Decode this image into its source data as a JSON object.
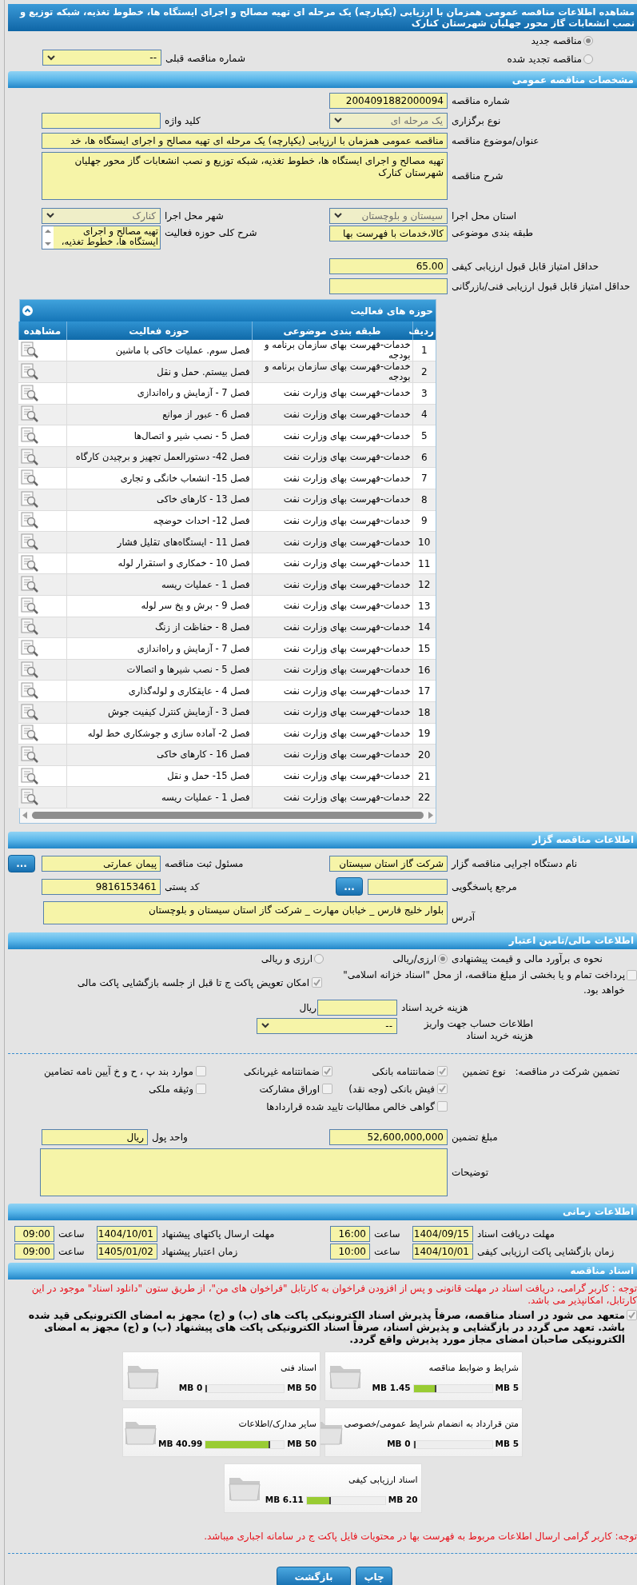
{
  "title": "مشاهده اطلاعات مناقصه عمومی همزمان با ارزیابی (یکپارچه) یک مرحله ای تهیه مصالح و اجرای ایستگاه ها، خطوط تغذیه، شبکه توزیع و نصب انشعابات گاز محور جهلیان شهرستان کنارک",
  "tender_kind": [
    {
      "label": "مناقصه جدید",
      "selected": true
    },
    {
      "label": "مناقصه تجدید شده",
      "selected": false
    }
  ],
  "previous_tender": {
    "label": "شماره مناقصه قبلی",
    "kind": "select",
    "value": "--",
    "disabled": false
  },
  "general": {
    "heading": "مشخصات مناقصه عمومی",
    "rows": [
      [
        {
          "label": "شماره مناقصه",
          "kind": "text",
          "value": "2004091882000094"
        }
      ],
      [
        {
          "label": "نوع برگزاری",
          "kind": "select",
          "value": "یک مرحله ای",
          "disabled": true
        },
        {
          "label": "کلید واژه",
          "kind": "text"
        }
      ],
      [
        {
          "label": "عنوان/موضوع مناقصه",
          "kind": "wide",
          "value": "مناقصه عمومی همزمان با ارزیابی (یکپارچه) یک مرحله ای تهیه مصالح و اجرای ایستگاه ها، خد"
        }
      ],
      [
        {
          "label": "شرح مناقصه",
          "kind": "textarea",
          "value": "تهیه مصالح و اجرای ایستگاه ها، خطوط تغذیه، شبکه توزیع و نصب انشعابات گاز محور جهلیان شهرستان کنارک"
        }
      ],
      [
        {
          "label": "استان محل اجرا",
          "kind": "select",
          "value": "سیستان و بلوچستان",
          "disabled": true
        },
        {
          "label": "شهر محل اجرا",
          "kind": "select",
          "value": "کنارک",
          "disabled": true
        }
      ],
      [
        {
          "label": "طبقه بندی موضوعی",
          "kind": "text",
          "value": "کالا،خدمات با فهرست بها"
        },
        {
          "label": "شرح کلی حوزه فعالیت",
          "kind": "listbox",
          "value": "تهیه مصالح و اجرای ایستگاه ها، خطوط تغذیه،"
        }
      ],
      [
        {
          "label": "حداقل امتیاز قابل قبول ارزیابی کیفی",
          "kind": "text",
          "value": "65.00"
        }
      ],
      [
        {
          "label": "حداقل امتیاز قابل قبول ارزیابی فنی/بازرگانی",
          "kind": "text"
        }
      ]
    ]
  },
  "activities": {
    "heading": "حوزه های فعالیت",
    "columns": [
      "ردیف",
      "طبقه بندی موضوعی",
      "حوزه فعالیت",
      "مشاهده"
    ],
    "rows": [
      [
        "1",
        "خدمات-فهرست بهای سازمان برنامه و بودجه",
        "فصل سوم. عملیات خاکی با ماشین"
      ],
      [
        "2",
        "خدمات-فهرست بهای سازمان برنامه و بودجه",
        "فصل بیستم. حمل و نقل"
      ],
      [
        "3",
        "خدمات-فهرست بهای وزارت نفت",
        "فصل 7 - آزمایش و راه‌اندازی"
      ],
      [
        "4",
        "خدمات-فهرست بهای وزارت نفت",
        "فصل 6 - عبور از موانع"
      ],
      [
        "5",
        "خدمات-فهرست بهای وزارت نفت",
        "فصل 5 - نصب شیر و اتصال‌ها"
      ],
      [
        "6",
        "خدمات-فهرست بهای وزارت نفت",
        "فصل 42- دستورالعمل تجهیز و برچیدن کارگاه"
      ],
      [
        "7",
        "خدمات-فهرست بهای وزارت نفت",
        "فصل 15- انشعاب خانگی و تجاری"
      ],
      [
        "8",
        "خدمات-فهرست بهای وزارت نفت",
        "فصل 13 - کارهای خاکی"
      ],
      [
        "9",
        "خدمات-فهرست بهای وزارت نفت",
        "فصل 12- احداث حوضچه"
      ],
      [
        "10",
        "خدمات-فهرست بهای وزارت نفت",
        "فصل 11 - ایستگاه‌های تقلیل فشار"
      ],
      [
        "11",
        "خدمات-فهرست بهای وزارت نفت",
        "فصل 10 - خمکاری و استقرار لوله"
      ],
      [
        "12",
        "خدمات-فهرست بهای وزارت نفت",
        "فصل 1 - عملیات ریسه"
      ],
      [
        "13",
        "خدمات-فهرست بهای وزارت نفت",
        "فصل 9 - برش و پخ سر لوله"
      ],
      [
        "14",
        "خدمات-فهرست بهای وزارت نفت",
        "فصل 8 - حفاظت از زنگ"
      ],
      [
        "15",
        "خدمات-فهرست بهای وزارت نفت",
        "فصل 7 - آزمایش و راه‌اندازی"
      ],
      [
        "16",
        "خدمات-فهرست بهای وزارت نفت",
        "فصل 5 - نصب شیرها و اتصالات"
      ],
      [
        "17",
        "خدمات-فهرست بهای وزارت نفت",
        "فصل 4 - عایقکاری و لوله‌گذاری"
      ],
      [
        "18",
        "خدمات-فهرست بهای وزارت نفت",
        "فصل 3 - آزمایش کنترل کیفیت جوش"
      ],
      [
        "19",
        "خدمات-فهرست بهای وزارت نفت",
        "فصل 2- آماده سازی و جوشکاری خط لوله"
      ],
      [
        "20",
        "خدمات-فهرست بهای وزارت نفت",
        "فصل 16 - کارهای خاکی"
      ],
      [
        "21",
        "خدمات-فهرست بهای وزارت نفت",
        "فصل 15- حمل و نقل"
      ],
      [
        "22",
        "خدمات-فهرست بهای وزارت نفت",
        "فصل 1 - عملیات ریسه"
      ]
    ]
  },
  "organizer": {
    "heading": "اطلاعات مناقصه گزار",
    "executive": {
      "label": "نام دستگاه اجرایی مناقصه گزار",
      "value": "شرکت گاز استان سیستان"
    },
    "registrar": {
      "label": "مسئول ثبت مناقصه",
      "value": "پیمان عمارتی",
      "button": "..."
    },
    "reference": {
      "label": "مرجع پاسخگویی",
      "button": "..."
    },
    "postal_code": {
      "label": "کد پستی",
      "value": "9816153461"
    },
    "address": {
      "label": "آدرس",
      "value": "بلوار خلیج فارس _ خیابان مهارت _ شرکت گاز استان سیستان و بلوچستان"
    }
  },
  "finance": {
    "heading": "اطلاعات مالی/تامین اعتبار",
    "estimate": {
      "label": "نحوه ی برآورد مالی و قیمت پیشنهادی",
      "options": [
        {
          "label": "ارزی/ریالی",
          "selected": true
        },
        {
          "label": "ارزی و ریالی",
          "selected": false
        }
      ]
    },
    "options": [
      {
        "label": "پرداخت تمام و یا بخشی از مبلغ مناقصه، از محل \"اسناد خزانه اسلامی\" خواهد بود.",
        "checked": false
      },
      {
        "label": "امکان تعویض پاکت ج تا قبل از جلسه بازگشایی پاکت مالی",
        "checked": true
      }
    ],
    "document_fee": {
      "label": "هزینه خرید اسناد",
      "unit": "ریال"
    },
    "account": {
      "label": "اطلاعات حساب جهت واریز هزینه خرید اسناد",
      "kind": "select",
      "value": "--",
      "disabled": false
    }
  },
  "guarantee": {
    "label": "تضمین شرکت در مناقصه:",
    "type_label": "نوع تضمین",
    "types": [
      {
        "label": "ضمانتنامه بانکی",
        "checked": true
      },
      {
        "label": "ضمانتنامه غیربانکی",
        "checked": true
      },
      {
        "label": "موارد بند پ ، ح و خ آیین نامه تضامین",
        "checked": false
      },
      {
        "label": "فیش بانکی (وجه نقد)",
        "checked": true
      },
      {
        "label": "اوراق مشارکت",
        "checked": false
      },
      {
        "label": "وثیقه ملکی",
        "checked": false
      },
      {
        "label": "گواهی خالص مطالبات تایید شده قراردادها",
        "checked": false
      }
    ],
    "amount": {
      "label": "مبلغ تضمین",
      "value": "52,600,000,000"
    },
    "currency": {
      "label": "واحد پول",
      "value": "ریال"
    },
    "notes": {
      "label": "توضیحات"
    }
  },
  "schedule": {
    "heading": "اطلاعات زمانی",
    "items": [
      {
        "label": "مهلت دریافت اسناد",
        "date": "1404/09/15",
        "time_label": "ساعت",
        "time": "16:00"
      },
      {
        "label": "مهلت ارسال پاکتهای پیشنهاد",
        "date": "1404/10/01",
        "time_label": "ساعت",
        "time": "09:00"
      },
      {
        "label": "زمان بازگشایی پاکت ارزیابی کیفی",
        "date": "1404/10/01",
        "time_label": "ساعت",
        "time": "10:00"
      },
      {
        "label": "زمان اعتبار پیشنهاد",
        "date": "1405/01/02",
        "time_label": "ساعت",
        "time": "09:00"
      }
    ]
  },
  "documents": {
    "heading": "اسناد مناقصه",
    "notice": "توجه : کاربر گرامی، دریافت اسناد در مهلت قانونی و پس از افزودن فراخوان به کارتابل \"فراخوان های من\"، از طریق ستون \"دانلود اسناد\" موجود در این کارتابل، امکانپذیر می باشد.",
    "commitment": {
      "text": "متعهد می شود در اسناد مناقصه، صرفاً پذیرش اسناد الکترونیکی پاکت های (ب) و (ج) مجهز به امضای الکترونیکی قید شده باشد. تعهد می گردد در بازگشایی و پذیرش اسناد، صرفاً اسناد الکترونیکی پاکت های پیشنهاد (ب) و (ج) مجهز به امضای الکترونیکی صاحبان امضای مجاز مورد پذیرش واقع گردد.",
      "checked": true
    },
    "files": [
      {
        "name": "شرایط و ضوابط مناقصه",
        "max": "5 MB",
        "used": "1.45 MB",
        "level": 0.29
      },
      {
        "name": "اسناد فنی",
        "max": "50 MB",
        "used": "0 MB",
        "level": 0
      },
      {
        "name": "متن قرارداد به انضمام شرایط عمومی/خصوصی",
        "max": "5 MB",
        "used": "0 MB",
        "level": 0
      },
      {
        "name": "سایر مدارک/اطلاعات",
        "max": "50 MB",
        "used": "40.99 MB",
        "level": 0.82
      },
      {
        "name": "اسناد ارزیابی کیفی",
        "max": "20 MB",
        "used": "6.11 MB",
        "level": 0.31
      }
    ],
    "footer_notice": "توجه: کاربر گرامی ارسال اطلاعات مربوط به فهرست بها در محتویات فایل پاکت ج در سامانه اجباری میباشد."
  },
  "buttons": [
    "چاپ",
    "بازگشت"
  ]
}
